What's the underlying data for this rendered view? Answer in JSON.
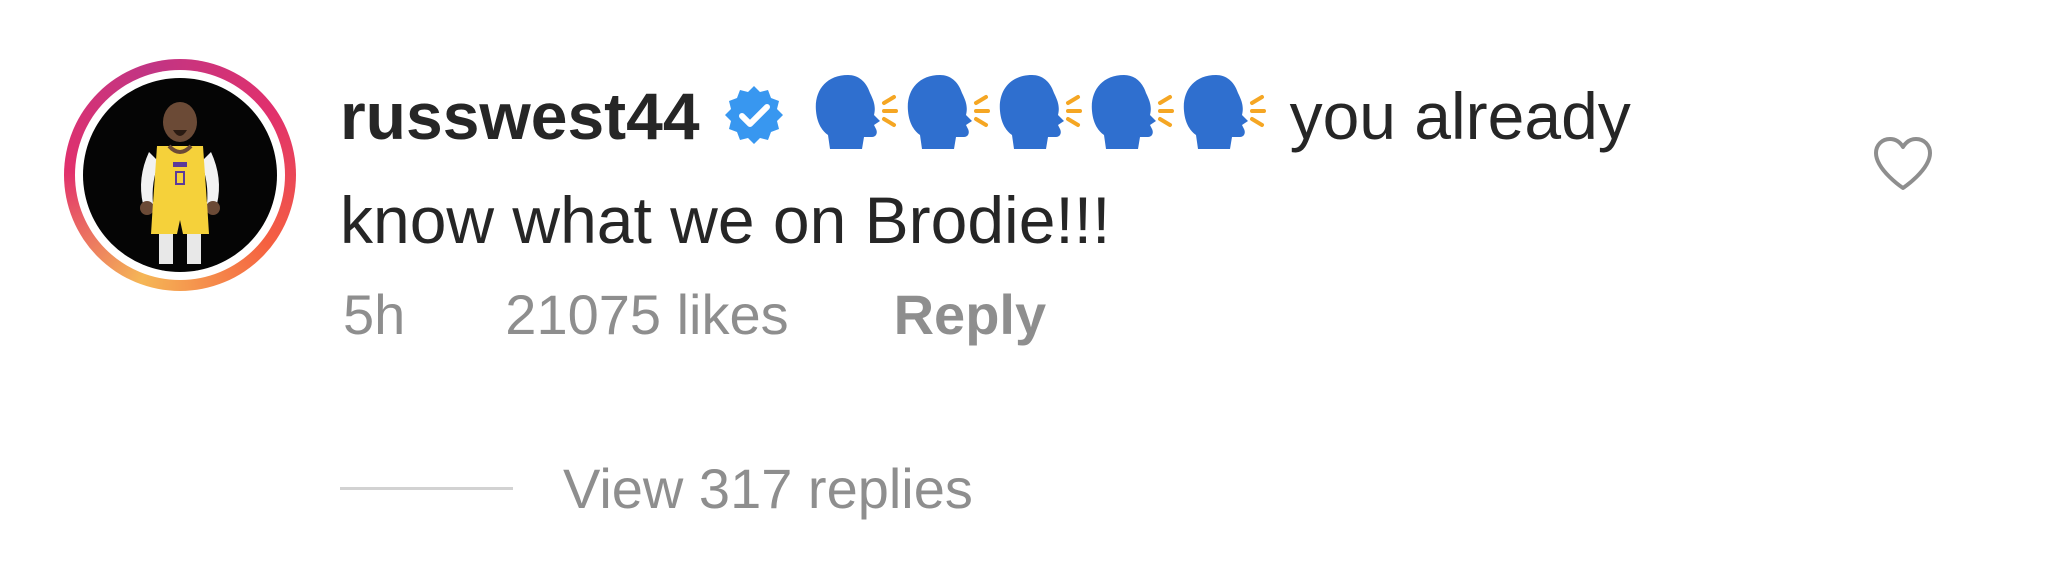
{
  "comment": {
    "username": "russwest44",
    "verified": true,
    "emojis": [
      "speaking-head",
      "speaking-head",
      "speaking-head",
      "speaking-head",
      "speaking-head"
    ],
    "text": "you already know what we on Brodie!!!",
    "time": "5h",
    "likes": "21075 likes",
    "reply_label": "Reply",
    "view_replies_label": "View 317 replies"
  },
  "icons": {
    "verified_badge": "verified-badge-icon",
    "like": "heart-outline-icon",
    "emoji": "speaking-head-emoji"
  },
  "colors": {
    "text_primary": "#262626",
    "text_secondary": "#8e8e8e",
    "verified_blue": "#3897f0",
    "emoji_blue": "#2f6fcf",
    "divider": "#d2d2d2"
  }
}
